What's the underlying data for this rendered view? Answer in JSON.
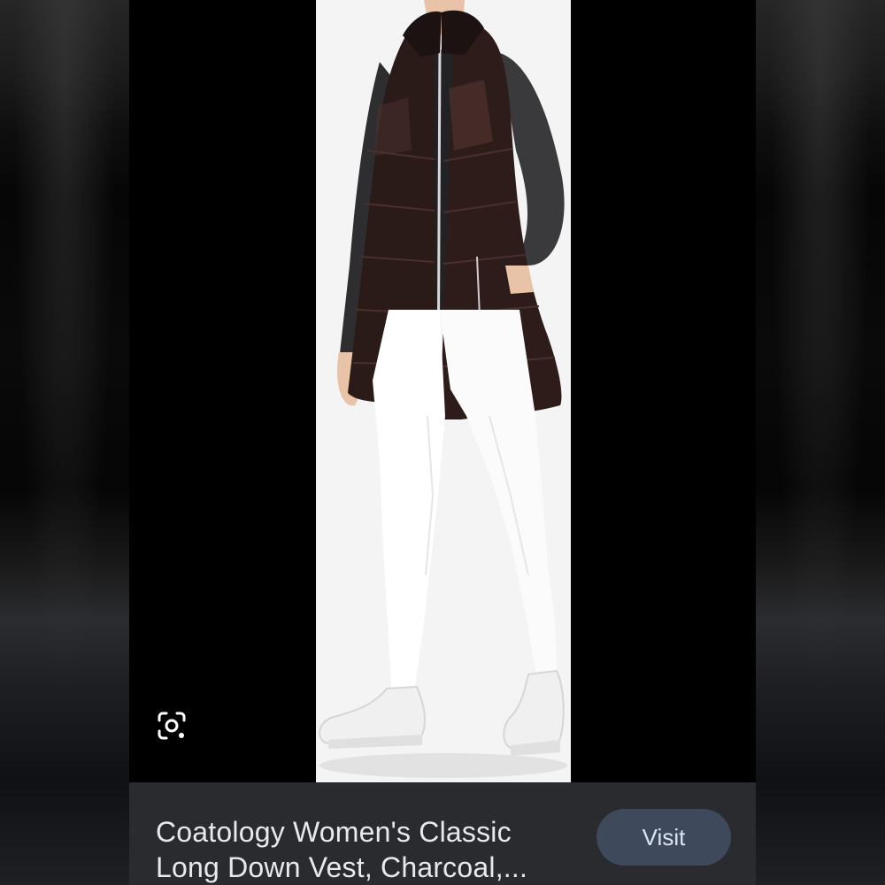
{
  "result": {
    "title": "Coatology Women's Classic Long Down Vest, Charcoal,...",
    "visit_label": "Visit"
  },
  "image": {
    "subject": "product-photo",
    "background_color": "#f4f4f4"
  },
  "icons": {
    "lens": "visual-search-icon"
  },
  "colors": {
    "info_bar": "#2a2b2f",
    "visit_button": "#3e4a5c",
    "visit_text": "#dce4f2",
    "title_text": "#e8e9ec"
  }
}
